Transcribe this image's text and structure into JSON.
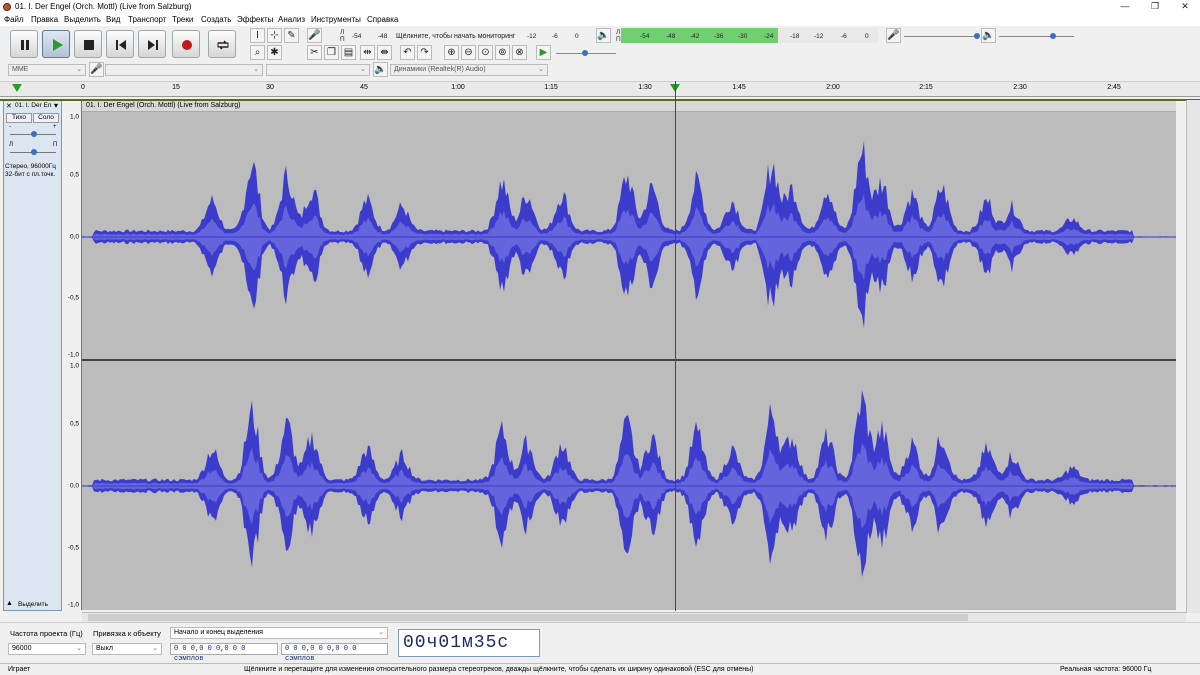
{
  "window": {
    "title": "01. I. Der Engel (Orch. Mottl) (Live from Salzburg)",
    "min_label": "—",
    "max_label": "❐",
    "close_label": "✕"
  },
  "menu": [
    "Файл",
    "Правка",
    "Выделить",
    "Вид",
    "Транспорт",
    "Треки",
    "Создать",
    "Эффекты",
    "Анализ",
    "Инструменты",
    "Справка"
  ],
  "transport": {
    "pause": "pause-icon",
    "play": "play-icon",
    "stop": "stop-icon",
    "skip_start": "skip-start-icon",
    "skip_end": "skip-end-icon",
    "record": "record-icon",
    "loop": "loop-icon"
  },
  "meters": {
    "record_label_l": "Л",
    "record_label_r": "П",
    "record_scale": [
      "-54",
      "-48",
      "-12",
      "-6",
      "0"
    ],
    "record_hint": "Щёлкните, чтобы начать мониторинг",
    "play_scale": [
      "-54",
      "-48",
      "-42",
      "-36",
      "-30",
      "-24",
      "-18",
      "-12",
      "-6",
      "0"
    ],
    "play_label_l": "Л",
    "play_label_r": "П"
  },
  "device": {
    "host": "MME",
    "input_device": "",
    "input_channels": "",
    "output_device": "Динамики (Realtek(R) Audio)"
  },
  "timeline": {
    "ticks": [
      "0",
      "15",
      "30",
      "45",
      "1:00",
      "1:15",
      "1:30",
      "1:45",
      "2:00",
      "2:15",
      "2:30",
      "2:45"
    ]
  },
  "track": {
    "name": "01. I. Der En",
    "clip_name": "01. I. Der Engel (Orch. Mottl) (Live from Salzburg)",
    "mute": "Тихо",
    "solo": "Соло",
    "gain_minus": "-",
    "gain_plus": "+",
    "pan_left": "Л",
    "pan_right": "П",
    "info_line1": "Стерео, 96000Гц",
    "info_line2": "32-бит с пл.точк.",
    "select": "Выделить",
    "close": "✕",
    "y_labels_top": [
      "1,0",
      "0,5",
      "0,0",
      "-0,5",
      "-1,0"
    ],
    "y_labels_bottom": [
      "1,0",
      "0,5",
      "0,0",
      "-0,5",
      "-1,0"
    ]
  },
  "bottom": {
    "rate_label": "Частота проекта (Гц)",
    "rate_value": "96000",
    "snap_label": "Привязка к объекту",
    "snap_value": "Выкл",
    "selection_mode": "Начало и конец выделения",
    "sel_start": "0 0 0,0 0 0,0 0 0  сэмплов",
    "sel_end": "0 0 0,0 0 0,0 0 0  сэмплов",
    "time": "00ч01м35с"
  },
  "status": {
    "state": "Играет",
    "hint": "Щёлкните и перетащите для изменения относительного размера стереотреков, дважды щёлкните, чтобы сделать их ширину одинаковой (ESC для отмены)",
    "rate": "Реальная частота: 96000 Гц"
  },
  "colors": {
    "waveform": "#3c3ccc",
    "waveform_rms": "#6464dc",
    "track_bg": "#bcbcbc",
    "meter_green": "#70d070"
  }
}
